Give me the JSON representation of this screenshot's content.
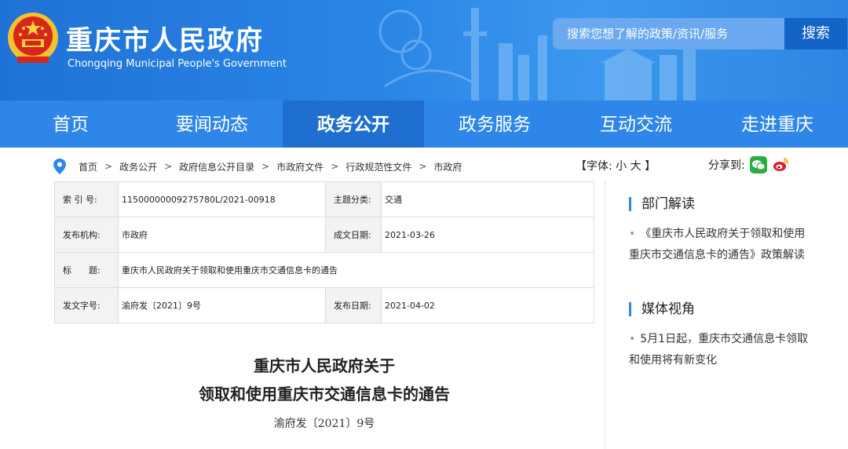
{
  "header": {
    "title": "重庆市人民政府",
    "subtitle": "Chongqing Municipal People's Government",
    "search_placeholder": "搜索您想了解的政策/资讯/服务",
    "search_button": "搜索"
  },
  "nav": {
    "items": [
      {
        "label": "首页"
      },
      {
        "label": "要闻动态"
      },
      {
        "label": "政务公开"
      },
      {
        "label": "政务服务"
      },
      {
        "label": "互动交流"
      },
      {
        "label": "走进重庆"
      }
    ],
    "active_index": 2
  },
  "breadcrumb": {
    "items": [
      "首页",
      "政务公开",
      "政府信息公开目录",
      "市政府文件",
      "行政规范性文件",
      "市政府"
    ],
    "separator": ">"
  },
  "font_size": {
    "open": "【字体:",
    "small": "小",
    "large": "大",
    "close": "】"
  },
  "share": {
    "label": "分享到:"
  },
  "info_table": {
    "index_label": "索 引 号:",
    "index_value": "11500000009275780L/2021-00918",
    "topic_label": "主题分类:",
    "topic_value": "交通",
    "publisher_label": "发布机构:",
    "publisher_value": "市政府",
    "created_label": "成文日期:",
    "created_value": "2021-03-26",
    "title_label": "标　　题:",
    "title_value": "重庆市人民政府关于领取和使用重庆市交通信息卡的通告",
    "docno_label": "发文字号:",
    "docno_value": "渝府发〔2021〕9号",
    "published_label": "发布日期:",
    "published_value": "2021-04-02"
  },
  "document": {
    "title_line1": "重庆市人民政府关于",
    "title_line2": "领取和使用重庆市交通信息卡的通告",
    "doc_number": "渝府发〔2021〕9号"
  },
  "sidebar": {
    "section1_title": "部门解读",
    "section1_item": "《重庆市人民政府关于领取和使用重庆市交通信息卡的通告》政策解读",
    "section2_title": "媒体视角",
    "section2_item": "5月1日起，重庆市交通信息卡领取和使用将有新变化"
  },
  "colors": {
    "header_blue": "#2a86e6",
    "nav_blue": "#2e86e8",
    "nav_active": "#1e6fd0",
    "search_button": "#1463c7"
  }
}
